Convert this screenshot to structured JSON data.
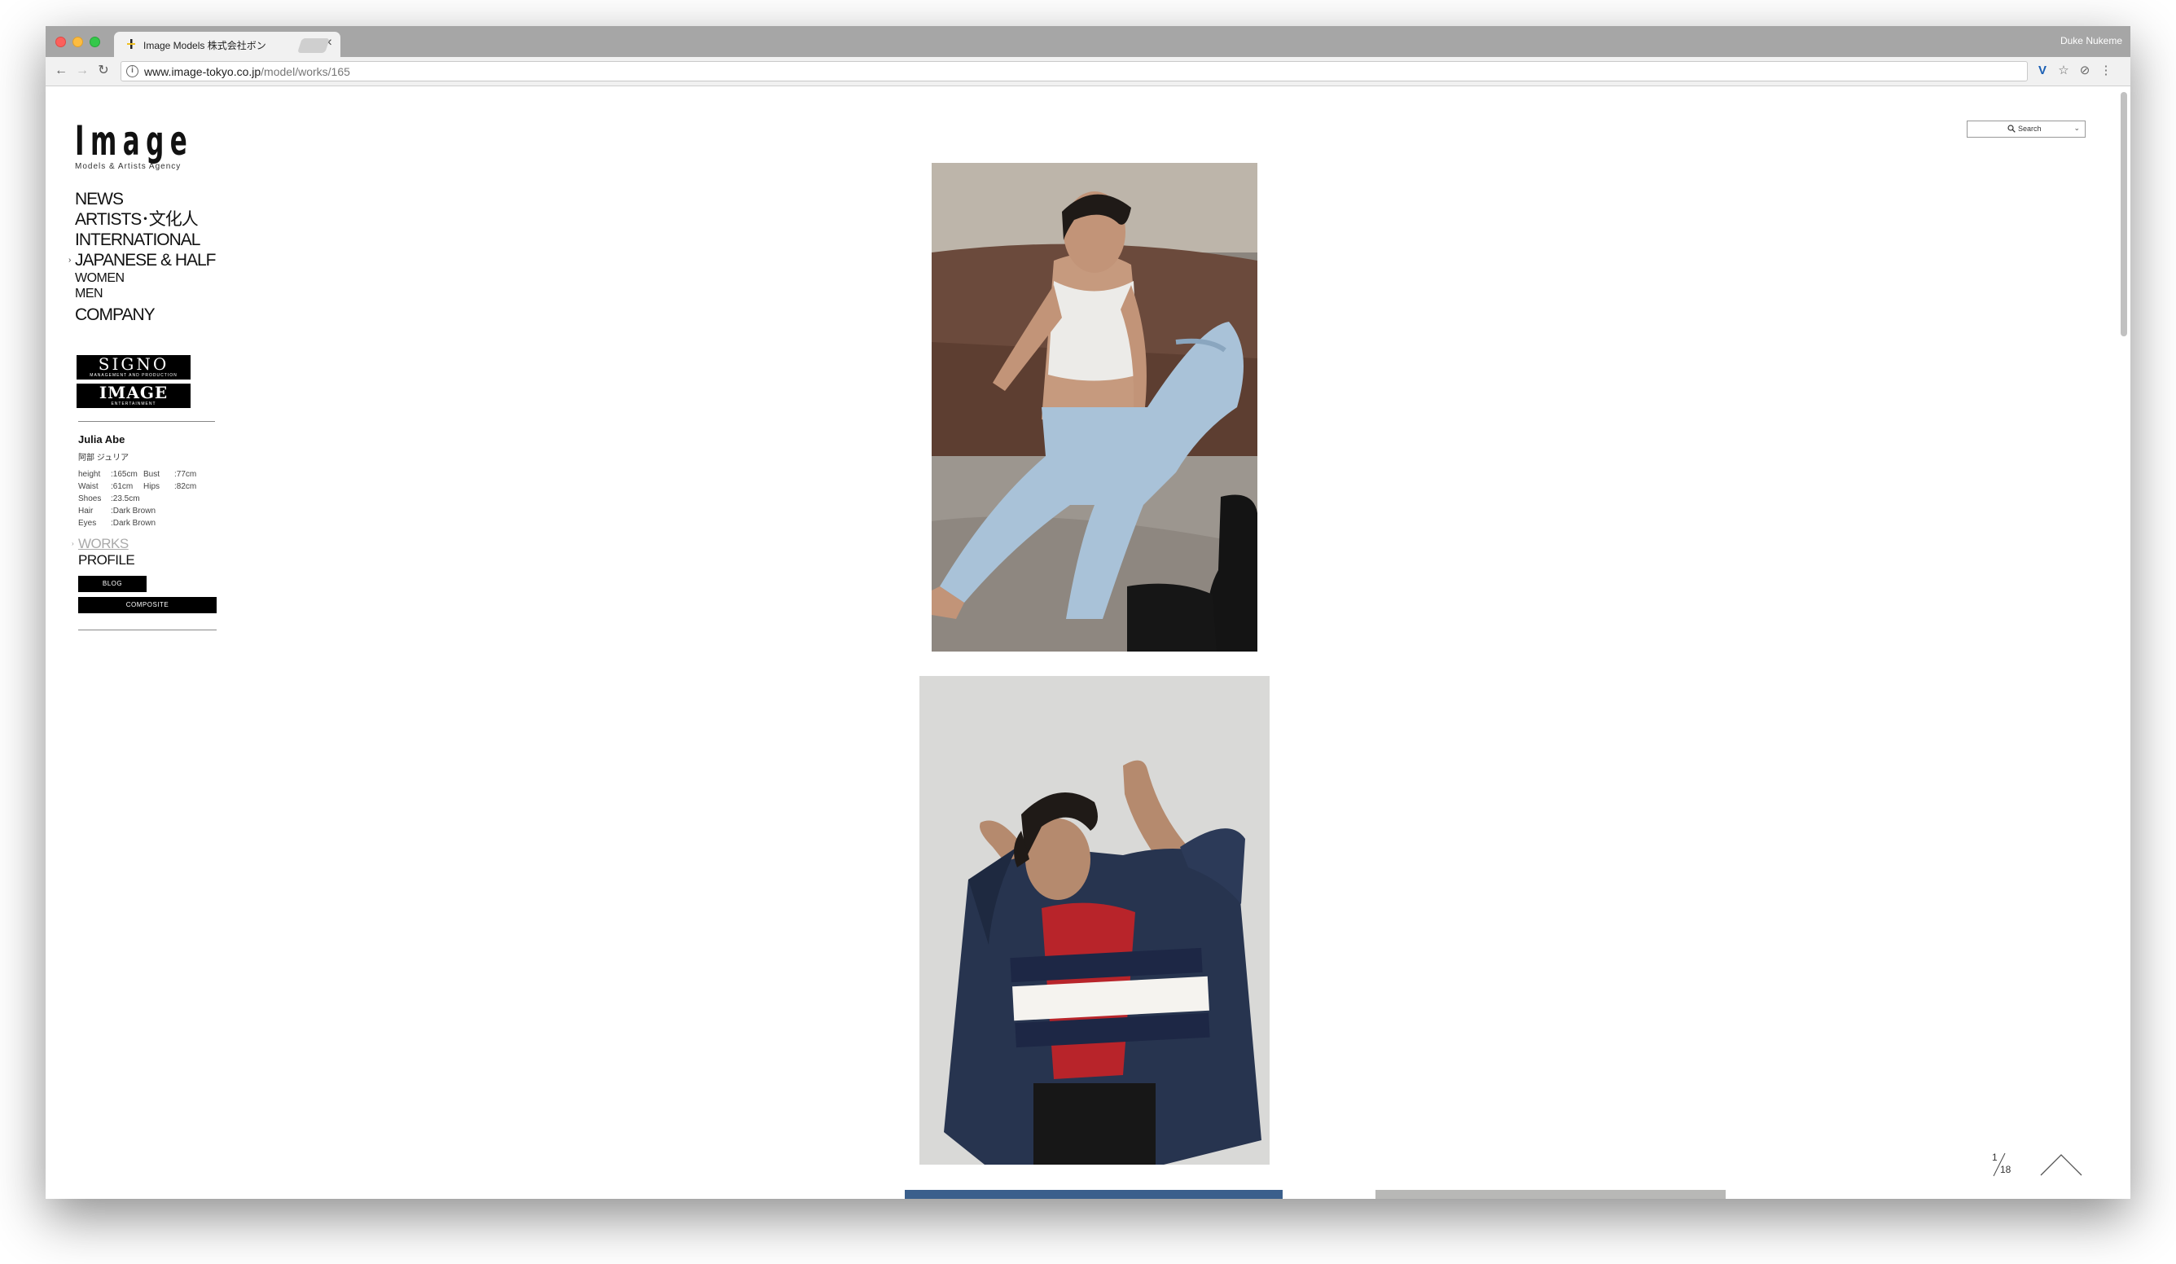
{
  "browser": {
    "tab_title": "Image Models 株式会社ボン",
    "profile_name": "Duke Nukeme",
    "url_host": "www.image-tokyo.co.jp",
    "url_path": "/model/works/165"
  },
  "site": {
    "logo_text": "Image",
    "logo_subtitle": "Models & Artists Agency",
    "nav": {
      "news": "NEWS",
      "artists": "ARTISTS･文化人",
      "international": "INTERNATIONAL",
      "japanese_half": "JAPANESE & HALF",
      "women": "WOMEN",
      "men": "MEN",
      "company": "COMPANY"
    },
    "banners": {
      "signo": "SIGNO",
      "signo_sub": "MANAGEMENT AND PRODUCTION",
      "image_ent": "IMAGE",
      "image_ent_sub": "ENTERTAINMENT"
    },
    "search_label": "Search"
  },
  "model": {
    "name": "Julia Abe",
    "name_kana": "阿部 ジュリア",
    "stats": [
      {
        "k1": "height",
        "v1": ":165cm",
        "k2": "Bust",
        "v2": ":77cm"
      },
      {
        "k1": "Waist",
        "v1": ":61cm",
        "k2": "Hips",
        "v2": ":82cm"
      },
      {
        "k1": "Shoes",
        "v1": ":23.5cm",
        "k2": "",
        "v2": ""
      },
      {
        "k1": "Hair",
        "v1": ":Dark Brown",
        "k2": "",
        "v2": ""
      },
      {
        "k1": "Eyes",
        "v1": ":Dark Brown",
        "k2": "",
        "v2": ""
      }
    ],
    "works_label": "WORKS",
    "profile_label": "PROFILE",
    "blog_label": "BLOG",
    "composite_label": "COMPOSITE"
  },
  "pager": {
    "current": "1",
    "total": "18"
  },
  "colors": {
    "sofa": "#6b4a3c",
    "jeans": "#a9c2d8",
    "denim_jacket": "#27344f",
    "sweater_red": "#b8242a"
  }
}
